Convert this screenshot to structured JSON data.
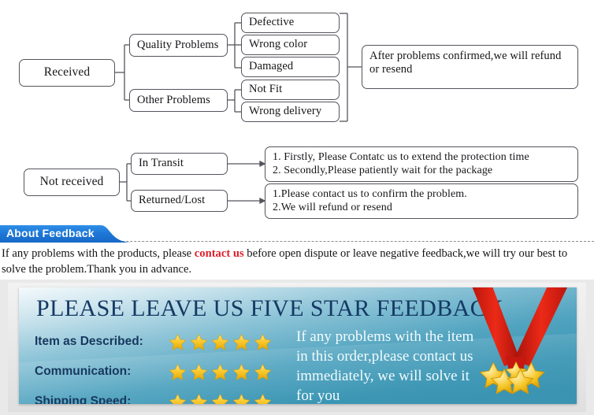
{
  "flowchart_received": {
    "root": "Received",
    "branches": [
      {
        "label": "Quality Problems",
        "items": [
          "Defective",
          "Wrong color",
          "Damaged"
        ]
      },
      {
        "label": "Other Problems",
        "items": [
          "Not Fit",
          "Wrong delivery"
        ]
      }
    ],
    "outcome_lines": [
      "After problems confirmed,we will refund",
      "or resend"
    ]
  },
  "flowchart_not_received": {
    "root": "Not received",
    "branches": [
      {
        "label": "In Transit",
        "outcome_lines": [
          "1. Firstly, Please Contatc us to extend the protection time",
          "2. Secondly,Please patiently wait for the package"
        ]
      },
      {
        "label": "Returned/Lost",
        "outcome_lines": [
          "1.Please contact us to confirm the problem.",
          "2.We will refund or resend"
        ]
      }
    ]
  },
  "about_feedback": {
    "tab_label": "About Feedback",
    "paragraph_part1": "If any problems with the products, please ",
    "paragraph_highlight": "contact us",
    "paragraph_part2": " before open dispute or leave negative feedback,we will try our best to solve the problem.Thank you in advance."
  },
  "feedback_banner": {
    "title": "PLEASE LEAVE US FIVE STAR FEEDBACK",
    "ratings": [
      {
        "label": "Item as Described:",
        "stars": 5
      },
      {
        "label": "Communication:",
        "stars": 5
      },
      {
        "label": "Shipping Speed:",
        "stars": 5
      }
    ],
    "message_lines": [
      "If any problems with the item",
      "in this order,please contact us",
      "immediately, we will solve it",
      "for you"
    ],
    "colors": {
      "title": "#143a64",
      "label": "#17385e",
      "star": "#f5c518",
      "ribbon": "#d81e12",
      "panel_top": "#f4fafc",
      "panel_bottom": "#3a93b1"
    }
  }
}
